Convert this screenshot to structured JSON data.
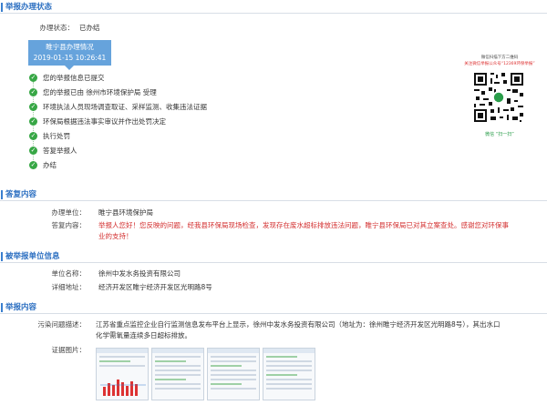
{
  "status_section": {
    "title": "举报办理状态",
    "state_label": "办理状态：",
    "state_value": "已办结",
    "stage_title": "睢宁县办理情况",
    "stage_time": "2019-01-15 10:26:41",
    "steps": [
      "您的举报信息已提交",
      "您的举报已由 徐州市环境保护局 受理",
      "环境执法人员现场调查取证、采样监测、收集违法证据",
      "环保局根据违法事实审议并作出处罚决定",
      "执行处罚",
      "答复举报人",
      "办结"
    ],
    "qr_caption_1": "微信扫描下方二维码",
    "qr_caption_2": "关注微信举报公众号“12369环保举报”",
    "qr_footer": "微信 “扫一扫”"
  },
  "reply_section": {
    "title": "答复内容",
    "unit_label": "办理单位：",
    "unit_value": "睢宁县环境保护局",
    "content_label": "答复内容：",
    "content_line1": "举报人您好！您反映的问题，经我县环保局现场检查，发现存在废水超标排放违法问题，睢宁县环保局已对其立案查处。感谢您对环保事",
    "content_line2": "业的支持！"
  },
  "reported_section": {
    "title": "被举报单位信息",
    "name_label": "单位名称：",
    "name_value": "徐州中发水务投资有限公司",
    "addr_label": "详细地址：",
    "addr_value": "经济开发区睢宁经济开发区光明路8号"
  },
  "report_section": {
    "title": "举报内容",
    "desc_label": "污染问题描述：",
    "desc_line1": "江苏省重点监控企业自行监测信息发布平台上显示，徐州中发水务投资有限公司（地址为：徐州睢宁经济开发区光明路8号），其出水口",
    "desc_line2": "化学需氧量连续多日超标排放。",
    "evidence_label": "证据图片："
  },
  "colors": {
    "accent": "#2c6fc1",
    "step_green": "#37a745",
    "stage_blue": "#66a3dc",
    "reply_red": "#d32f2f"
  },
  "icons": [
    "check-circle-icon",
    "qr-code-icon"
  ]
}
